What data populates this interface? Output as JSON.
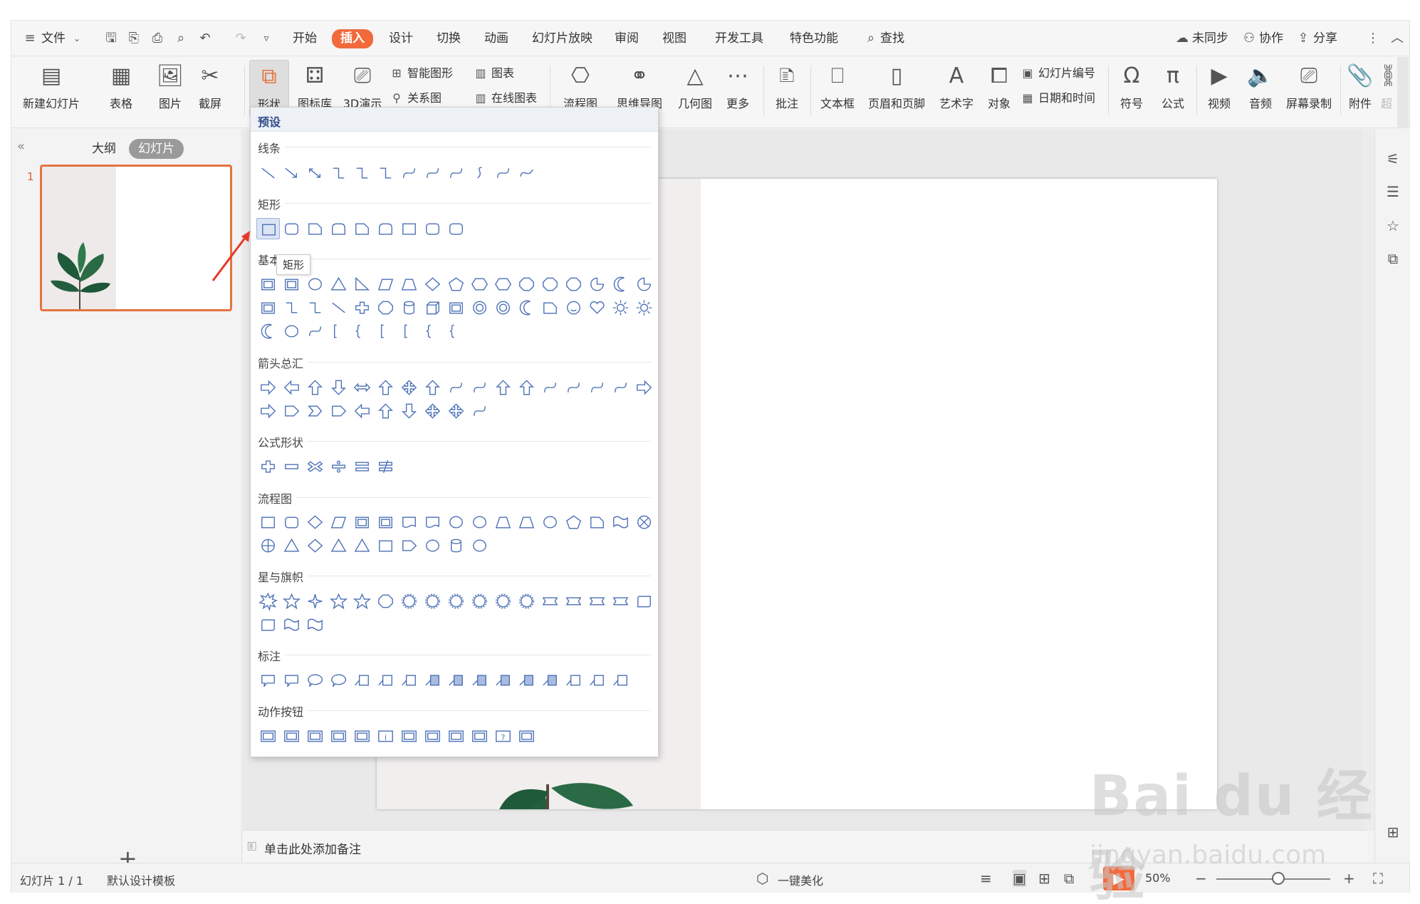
{
  "menu": {
    "hamburger_label": "文件",
    "items": [
      "开始",
      "插入",
      "设计",
      "切换",
      "动画",
      "幻灯片放映",
      "审阅",
      "视图",
      "开发工具",
      "特色功能"
    ],
    "search_label": "查找",
    "right": [
      "未同步",
      "协作",
      "分享"
    ]
  },
  "ribbon": {
    "new_slide": "新建幻灯片",
    "table": "表格",
    "picture": "图片",
    "screenshot": "截屏",
    "shape": "形状",
    "icon_lib": "图标库",
    "demo3d": "3D演示",
    "smart_art": "智能图形",
    "chart": "图表",
    "relation": "关系图",
    "online_chart": "在线图表",
    "flowchart": "流程图",
    "mindmap": "思维导图",
    "geometry": "几何图",
    "more": "更多",
    "comment": "批注",
    "textbox": "文本框",
    "header_footer": "页眉和页脚",
    "wordart": "艺术字",
    "object": "对象",
    "slide_number": "幻灯片编号",
    "datetime": "日期和时间",
    "symbol": "符号",
    "formula": "公式",
    "video": "视频",
    "audio": "音频",
    "screen_record": "屏幕录制",
    "attachment": "附件",
    "super": "超"
  },
  "leftpanel": {
    "tab_outline": "大纲",
    "tab_slides": "幻灯片",
    "slide_number": "1"
  },
  "notes_placeholder": "单击此处添加备注",
  "status": {
    "slide_info": "幻灯片 1 / 1",
    "template": "默认设计模板",
    "beautify": "一键美化",
    "zoom": "50%"
  },
  "dropdown": {
    "header": "预设",
    "categories": {
      "lines": "线条",
      "rect": "矩形",
      "basic": "基本形状",
      "arrows": "箭头总汇",
      "formula": "公式形状",
      "flow": "流程图",
      "stars": "星与旗帜",
      "callouts": "标注",
      "actions": "动作按钮"
    },
    "tooltip": "矩形"
  },
  "watermark": {
    "brand": "Bai du 经验",
    "url": "jingyan.baidu.com"
  },
  "colors": {
    "accent": "#f26a3c",
    "shape_stroke": "#4a6fb5",
    "selection": "#e4733f"
  }
}
